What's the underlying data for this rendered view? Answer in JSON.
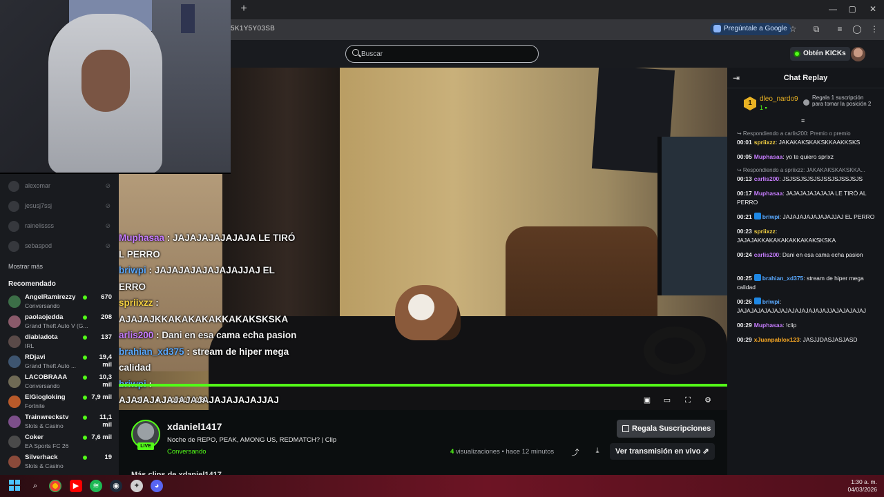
{
  "browser": {
    "new_tab_symbol": "+",
    "url_fragment": "5K1Y5Y03SB",
    "ask_google_label": "Pregúntale a Google",
    "window_controls": [
      "—",
      "▢",
      "✕"
    ]
  },
  "header": {
    "search_placeholder": "Buscar",
    "get_kicks_label": "Obtén KICKs"
  },
  "sidebar": {
    "following": [
      {
        "name": "alexomar"
      },
      {
        "name": "jesusj7ssj"
      },
      {
        "name": "rainelissss"
      },
      {
        "name": "sebaspod"
      }
    ],
    "show_more_label": "Mostrar más",
    "recommended_label": "Recomendado",
    "recommended": [
      {
        "name": "AngelRamirezzy",
        "category": "Conversando",
        "viewers": "670",
        "avatar_color": "#3c6e47"
      },
      {
        "name": "paolaojedda",
        "category": "Grand Theft Auto V (G...",
        "viewers": "208",
        "avatar_color": "#8a5a6a"
      },
      {
        "name": "diabladota",
        "category": "IRL",
        "viewers": "137",
        "avatar_color": "#5a4a48"
      },
      {
        "name": "RDjavi",
        "category": "Grand Theft Auto ...",
        "viewers": "19,4 mil",
        "avatar_color": "#3e5570"
      },
      {
        "name": "LACOBRAAA",
        "category": "Conversando",
        "viewers": "10,3 mil",
        "avatar_color": "#6f6a55"
      },
      {
        "name": "ElGiogloking",
        "category": "Fortnite",
        "viewers": "7,9 mil",
        "avatar_color": "#b85a2a"
      },
      {
        "name": "Trainwreckstv",
        "category": "Slots & Casino",
        "viewers": "11,1 mil",
        "avatar_color": "#7c4f8a"
      },
      {
        "name": "Coker",
        "category": "EA Sports FC 26",
        "viewers": "7,6 mil",
        "avatar_color": "#4a4a4a"
      },
      {
        "name": "Silverhack",
        "category": "Slots & Casino",
        "viewers": "19",
        "avatar_color": "#8a4a3a"
      }
    ]
  },
  "video": {
    "overlay_chat": [
      {
        "user": "Muphasaa",
        "user_color": "#c77dff",
        "text": " : JAJAJAJAJAJAJA LE TIRÓ"
      },
      {
        "user": "",
        "user_color": "#f3f3f3",
        "text": "L PERRO"
      },
      {
        "user": " briwpi",
        "user_color": "#5aa9ff",
        "text": " : JAJAJAJAJAJAJAJJAJ EL"
      },
      {
        "user": "",
        "user_color": "#f3f3f3",
        "text": "ERRO"
      },
      {
        "user": "spriixzz",
        "user_color": "#f5d142",
        "text": " :"
      },
      {
        "user": "",
        "user_color": "#f3f3f3",
        "text": "AJAJAJKKAKAKAKAKKAKAKSKSKA"
      },
      {
        "user": "arlis200",
        "user_color": "#c77dff",
        "text": " : Dani en esa cama echa pasion"
      },
      {
        "user": " brahian_xd375",
        "user_color": "#5aa9ff",
        "text": " : stream de hiper mega"
      },
      {
        "user": "",
        "user_color": "#f3f3f3",
        "text": "calidad"
      },
      {
        "user": " briwpi",
        "user_color": "#5aa9ff",
        "text": " :"
      },
      {
        "user": "",
        "user_color": "#f3f3f3",
        "text": "AJAJAJAJAJAJAJAJAJAJAJAJJAJ"
      }
    ],
    "time_current": "00:30",
    "time_total": "00:30",
    "progress": 1.0
  },
  "clip": {
    "channel_name": "xdaniel1417",
    "live_badge": "LIVE",
    "title": "Noche de REPO, PEAK, AMONG US, REDMATCH? | Clip",
    "category": "Conversando",
    "gift_button_label": "Regala Suscripciones",
    "views_count": "4",
    "views_label": " visualizaciones",
    "time_ago": " • hace 12 minutos",
    "watch_live_label": "Ver transmisión en vivo ⇗",
    "more_clips_label": "Más clips de xdaniel1417"
  },
  "chat": {
    "title": "Chat Replay",
    "leader": {
      "rank": "1",
      "name": "dleo_nardo9",
      "value": "1 ▪"
    },
    "gift_info": "Regala 1 suscripción para tomar la posición 2",
    "messages": [
      {
        "reply_to": "↪ Respondiendo a carlis200: Premio o premio",
        "time": "00:01",
        "user": "spriixzz",
        "user_color": "#f5d142",
        "verified": false,
        "text": ": JAKAKAKSKAKSKKAAKKSKS"
      },
      {
        "reply_to": "",
        "time": "00:05",
        "user": "Muphasaa",
        "user_color": "#c77dff",
        "verified": false,
        "text": ": yo te quiero sprixz"
      },
      {
        "reply_to": "↪ Respondiendo a spriixzz: JAKAKAKSKAKSKKA...",
        "time": "00:13",
        "user": "carlis200",
        "user_color": "#c77dff",
        "verified": false,
        "text": ": JSJSSJSJSJSJSSJSJSSJSJS"
      },
      {
        "reply_to": "",
        "time": "00:17",
        "user": "Muphasaa",
        "user_color": "#c77dff",
        "verified": false,
        "text": ": JAJAJAJAJAJAJA LE TIRÓ AL PERRO"
      },
      {
        "reply_to": "",
        "time": "00:21",
        "user": "briwpi",
        "user_color": "#5aa9ff",
        "verified": true,
        "text": ": JAJAJAJAJAJAJAJJAJ EL PERRO"
      },
      {
        "reply_to": "",
        "time": "00:23",
        "user": "spriixzz",
        "user_color": "#f5d142",
        "verified": false,
        "text": ": JAJAJAKKAKAKAKAKKAKAKSKSKA"
      },
      {
        "reply_to": "",
        "time": "00:24",
        "user": "carlis200",
        "user_color": "#c77dff",
        "verified": false,
        "text": ": Dani en esa cama echa pasion"
      },
      {
        "reply_to": "",
        "time": "00:25",
        "user": "brahian_xd375",
        "user_color": "#5aa9ff",
        "verified": true,
        "text": ": stream de hiper mega calidad"
      },
      {
        "reply_to": "",
        "time": "00:26",
        "user": "briwpi",
        "user_color": "#5aa9ff",
        "verified": true,
        "text": ": JAJAJAJAJAJAJAJAJAJAJAJAJAJJAJAJAJAJAJ"
      },
      {
        "reply_to": "",
        "time": "00:29",
        "user": "Muphasaa",
        "user_color": "#c77dff",
        "verified": false,
        "text": ": !clip"
      },
      {
        "reply_to": "",
        "time": "00:29",
        "user": "xJuanpablox123",
        "user_color": "#f5a623",
        "verified": false,
        "text": ": JASJJDASJASJASD"
      }
    ]
  },
  "taskbar": {
    "time": "1:30 a. m.",
    "date": "04/03/2026"
  }
}
